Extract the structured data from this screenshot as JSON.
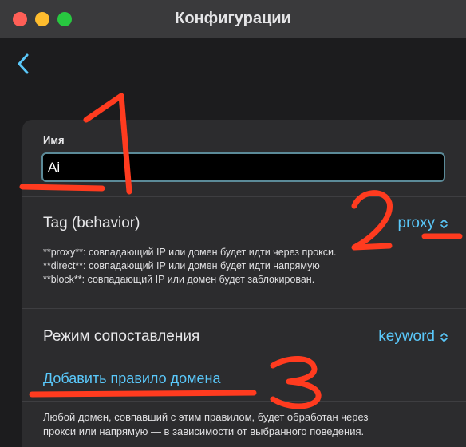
{
  "window": {
    "title": "Конфигурации"
  },
  "colors": {
    "accent": "#5ac8fa",
    "annotation": "#ff3b1f"
  },
  "form": {
    "name_label": "Имя",
    "name_value": "Ai",
    "tag": {
      "label": "Tag (behavior)",
      "value": "proxy",
      "help": [
        "**proxy**: совпадающий IP или домен будет идти через прокси.",
        "**direct**: совпадающий IP или домен будет идти напрямую",
        "**block**: совпадающий IP или домен будет заблокирован."
      ]
    },
    "match_mode": {
      "label": "Режим сопоставления",
      "value": "keyword"
    },
    "add_rule_link": "Добавить правило домена",
    "rule_help": [
      "Любой домен, совпавший с этим правилом, будет обработан через",
      "прокси или напрямую — в зависимости от выбранного поведения."
    ]
  },
  "icons": {
    "back": "chevron-left-icon",
    "select": "chevron-up-down-icon"
  }
}
